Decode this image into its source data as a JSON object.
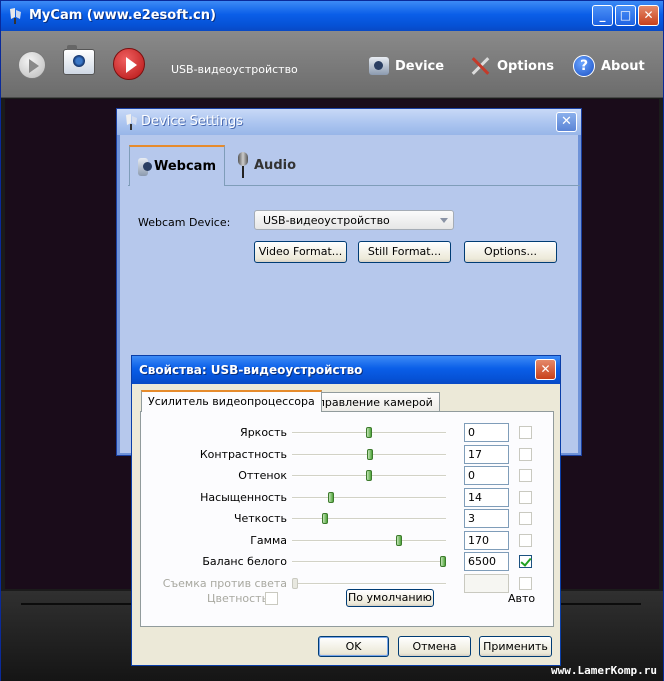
{
  "main_window": {
    "title": "MyCam (www.e2esoft.cn)",
    "minimize_glyph": "_",
    "maximize_glyph": "□",
    "close_glyph": "✕",
    "toolbar": {
      "device_name": "USB-видеоустройство",
      "device_label": "Device",
      "options_label": "Options",
      "about_label": "About",
      "help_glyph": "?"
    },
    "watermark": "www.LamerKomp.ru"
  },
  "device_settings": {
    "title": "Device Settings",
    "close_glyph": "✕",
    "tabs": [
      "Webcam",
      "Audio"
    ],
    "webcam_device_label": "Webcam Device:",
    "webcam_device_value": "USB-видеоустройство",
    "buttons": [
      "Video Format...",
      "Still Format...",
      "Options..."
    ]
  },
  "properties": {
    "title": "Свойства: USB-видеоустройство",
    "close_glyph": "✕",
    "tabs": [
      "Усилитель видеопроцессора",
      "Управление камерой"
    ],
    "rows": [
      {
        "label": "Яркость",
        "value": "0",
        "slider": 0.5,
        "auto": false,
        "enabled": true
      },
      {
        "label": "Контрастность",
        "value": "17",
        "slider": 0.51,
        "auto": false,
        "enabled": true
      },
      {
        "label": "Оттенок",
        "value": "0",
        "slider": 0.5,
        "auto": false,
        "enabled": true
      },
      {
        "label": "Насыщенность",
        "value": "14",
        "slider": 0.24,
        "auto": false,
        "enabled": true
      },
      {
        "label": "Четкость",
        "value": "3",
        "slider": 0.2,
        "auto": false,
        "enabled": true
      },
      {
        "label": "Гамма",
        "value": "170",
        "slider": 0.7,
        "auto": false,
        "enabled": true
      },
      {
        "label": "Баланс белого",
        "value": "6500",
        "slider": 1.0,
        "auto": true,
        "enabled": true
      },
      {
        "label": "Съемка против света",
        "value": "",
        "slider": 0.0,
        "auto": false,
        "enabled": false
      }
    ],
    "color_label": "Цветность",
    "default_button": "По умолчанию",
    "auto_label": "Авто",
    "ok": "OK",
    "cancel": "Отмена",
    "apply": "Применить"
  },
  "colors": {
    "xp_title_blue": "#0a5ee8",
    "device_panel": "#b6c8ec",
    "toolbar_gray": "#7a7a7a",
    "record_red": "#c41a1a",
    "checkbox_green": "#21a121"
  }
}
